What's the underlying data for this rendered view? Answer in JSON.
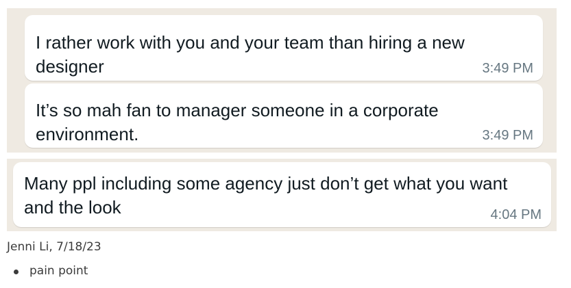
{
  "chat": {
    "messages": [
      {
        "text": "I rather work with you and your team than hiring a new designer",
        "time": "3:49 PM"
      },
      {
        "text": "It’s so mah fan to manager someone in a corporate environment.",
        "time": "3:49 PM"
      },
      {
        "text": "Many ppl including some agency just don’t get what you want and the look",
        "time": "4:04 PM"
      }
    ],
    "colors": {
      "background": "#efeae2",
      "bubble": "#ffffff",
      "timestamp": "#667781"
    }
  },
  "note": {
    "caption": "Jenni Li, 7/18/23",
    "bullets": [
      "pain point"
    ]
  }
}
